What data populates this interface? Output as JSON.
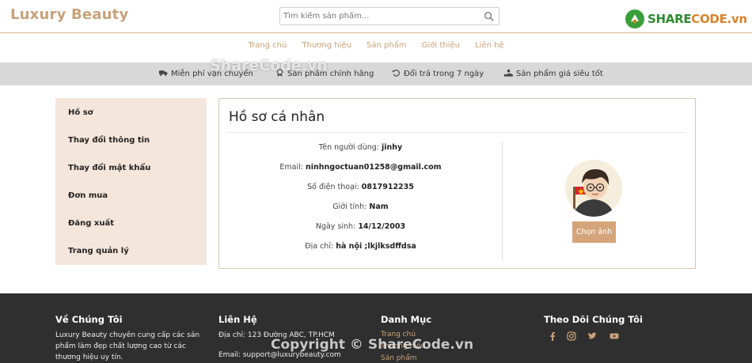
{
  "header": {
    "brand": "Luxury Beauty",
    "search_placeholder": "Tìm kiếm sản phẩm...",
    "logo_text_left": "SHARE",
    "logo_text_right": "CODE.vn"
  },
  "nav": {
    "items": [
      {
        "label": "Trang chủ"
      },
      {
        "label": "Thương hiệu"
      },
      {
        "label": "Sản phẩm"
      },
      {
        "label": "Giới thiệu"
      },
      {
        "label": "Liên hệ"
      }
    ]
  },
  "promo": {
    "items": [
      {
        "label": "Miễn phí vận chuyển",
        "icon": "truck-icon"
      },
      {
        "label": "Sản phẩm chính hãng",
        "icon": "badge-icon"
      },
      {
        "label": "Đổi trả trong 7 ngày",
        "icon": "undo-icon"
      },
      {
        "label": "Sản phẩm giá siêu tốt",
        "icon": "hand-coin-icon"
      }
    ]
  },
  "watermark": {
    "top": "ShareCode.vn",
    "bottom": "Copyright © ShareCode.vn"
  },
  "sidebar": {
    "items": [
      {
        "label": "Hồ sơ"
      },
      {
        "label": "Thay đổi thông tin"
      },
      {
        "label": "Thay đổi mật khẩu"
      },
      {
        "label": "Đơn mua"
      },
      {
        "label": "Đăng xuất"
      },
      {
        "label": "Trang quản lý"
      }
    ]
  },
  "profile": {
    "title": "Hồ sơ cá nhân",
    "fields": [
      {
        "label": "Tên người dùng:",
        "value": "jinhy"
      },
      {
        "label": "Email:",
        "value": "ninhngoctuan01258@gmail.com"
      },
      {
        "label": "Số điện thoại:",
        "value": "0817912235"
      },
      {
        "label": "Giới tính:",
        "value": "Nam"
      },
      {
        "label": "Ngày sinh:",
        "value": "14/12/2003"
      },
      {
        "label": "Địa chỉ:",
        "value": "hà nội ;lkjlksdffdsa"
      }
    ],
    "choose_image_label": "Chọn ảnh"
  },
  "footer": {
    "about": {
      "heading": "Về Chúng Tôi",
      "text": "Luxury Beauty chuyên cung cấp các sản phẩm làm đẹp chất lượng cao từ các thương hiệu uy tín."
    },
    "contact": {
      "heading": "Liên Hệ",
      "address": "Địa chỉ: 123 Đường ABC, TP.HCM",
      "email": "Email: support@luxurybeauty.com"
    },
    "categories": {
      "heading": "Danh Mục",
      "links": [
        "Trang chủ",
        "Thương hiệu",
        "Sản phẩm"
      ]
    },
    "follow": {
      "heading": "Theo Dõi Chúng Tôi",
      "icons": [
        "facebook-icon",
        "instagram-icon",
        "twitter-icon",
        "youtube-icon"
      ]
    }
  },
  "colors": {
    "accent": "#c8a27a",
    "button": "#d4a57a",
    "sidebar_bg": "#f5e6dc",
    "promo_bg": "#d8d8d8",
    "footer_bg": "#2f2f2f"
  }
}
